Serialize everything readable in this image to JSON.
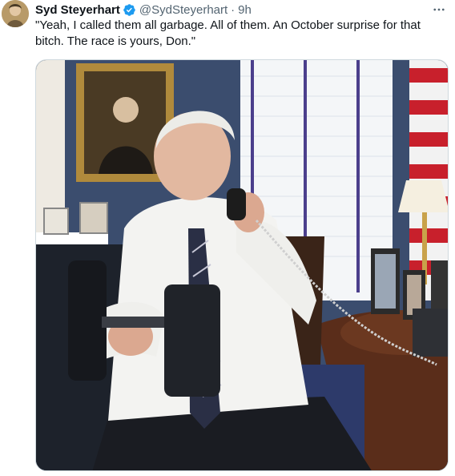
{
  "tweet": {
    "author_name": "Syd Steyerhart",
    "verified": true,
    "handle": "@SydSteyerhart",
    "separator": "·",
    "time": "9h",
    "text": "\"Yeah, I called them all garbage. All of them. An October surprise for that bitch. The race is yours, Don.\"",
    "more_icon": "more-horizontal-icon",
    "verified_icon": "verified-badge-icon"
  },
  "colors": {
    "verified_blue": "#1d9bf0",
    "secondary_text": "#536471",
    "primary_text": "#0f1419"
  }
}
